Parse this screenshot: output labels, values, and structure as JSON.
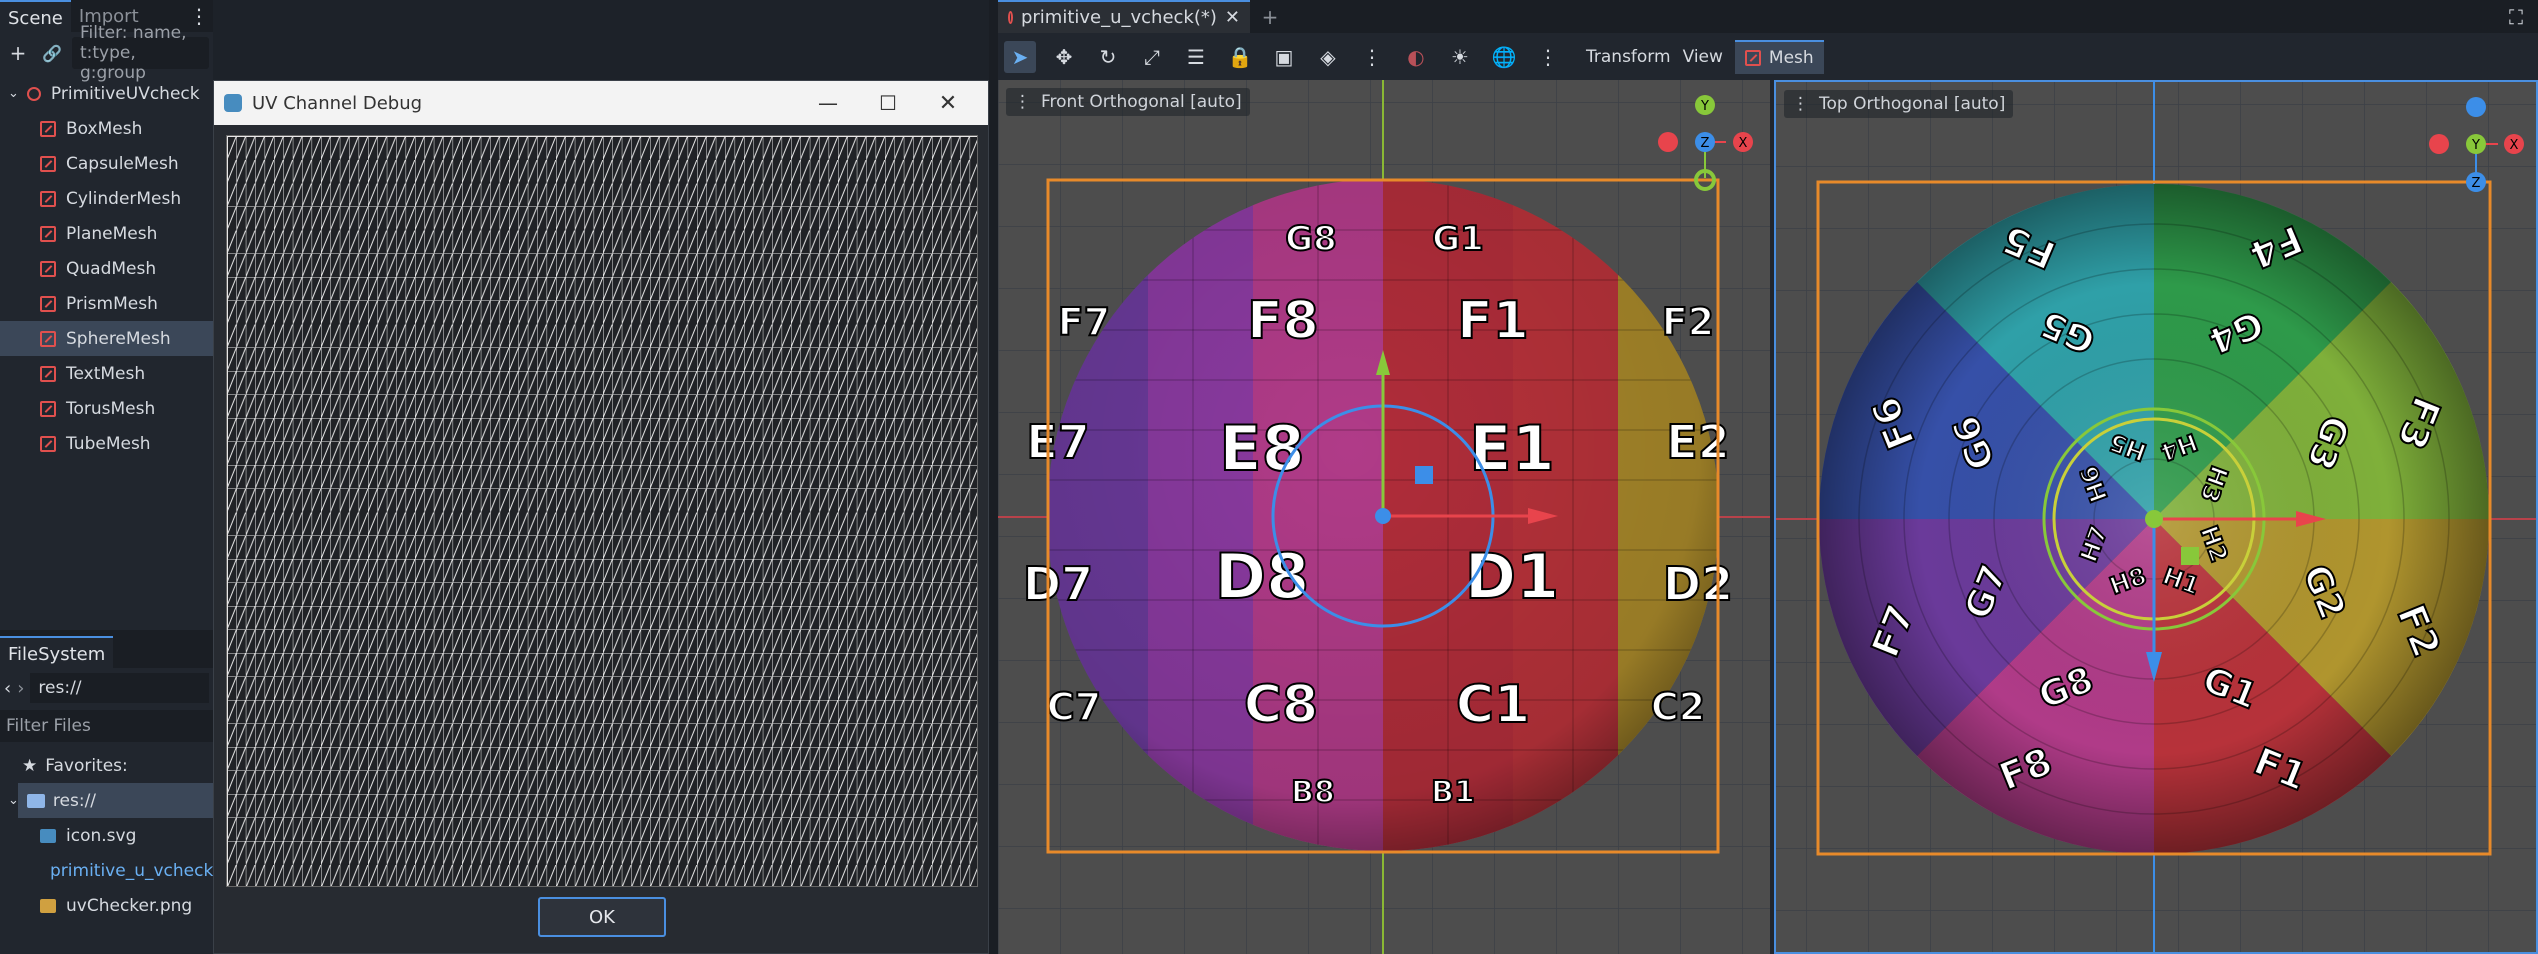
{
  "scene_dock": {
    "tabs": [
      "Scene",
      "Import"
    ],
    "filter_placeholder": "Filter: name, t:type, g:group",
    "root": "PrimitiveUVcheck",
    "nodes": [
      "BoxMesh",
      "CapsuleMesh",
      "CylinderMesh",
      "PlaneMesh",
      "QuadMesh",
      "PrismMesh",
      "SphereMesh",
      "TextMesh",
      "TorusMesh",
      "TubeMesh"
    ],
    "selected": "SphereMesh"
  },
  "filesystem": {
    "title": "FileSystem",
    "path": "res://",
    "filter_label": "Filter Files",
    "favorites": "Favorites:",
    "root": "res://",
    "files": [
      "icon.svg",
      "primitive_u_vcheck",
      "uvChecker.png"
    ]
  },
  "dialog": {
    "title": "UV Channel Debug",
    "ok_label": "OK"
  },
  "editor": {
    "tab_title": "primitive_u_vcheck(*)",
    "menu": [
      "Transform",
      "View"
    ],
    "mesh_menu": "Mesh",
    "viewport_left": "Front Orthogonal [auto]",
    "viewport_right": "Top Orthogonal [auto]",
    "front_labels": [
      "G8",
      "G1",
      "F7",
      "F8",
      "F1",
      "F2",
      "E7",
      "E8",
      "E1",
      "E2",
      "D7",
      "D8",
      "D1",
      "D2",
      "C7",
      "C8",
      "C1",
      "C2",
      "B8",
      "B1"
    ],
    "top_labels": [
      "F5",
      "F4",
      "G5",
      "G4",
      "F6",
      "G6",
      "F3",
      "G3",
      "H5",
      "H4",
      "H6",
      "H3",
      "H7",
      "H2",
      "H8",
      "H1",
      "G7",
      "G2",
      "F7",
      "F2",
      "G8",
      "G1",
      "F8",
      "F1"
    ],
    "colors": {
      "accent": "#4a8fe0",
      "selection": "#f0902a",
      "gizmo_x": "#e8444c",
      "gizmo_y": "#88c83a",
      "gizmo_z": "#3c8ee8"
    }
  }
}
